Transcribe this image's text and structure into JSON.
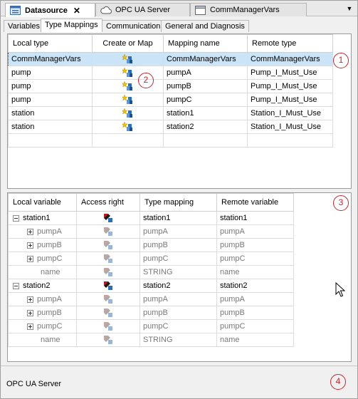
{
  "doc_tabs": [
    {
      "label": "Datasource",
      "active": true
    },
    {
      "label": "OPC UA Server",
      "active": false
    },
    {
      "label": "CommManagerVars",
      "active": false
    }
  ],
  "doc_tabs_close": "✕",
  "doc_tabs_dropdown": "▼",
  "sub_tabs": [
    "Variables",
    "Type Mappings",
    "Communication",
    "General and Diagnosis"
  ],
  "type_mappings": {
    "columns": [
      "Local type",
      "Create or Map",
      "Mapping name",
      "Remote type"
    ],
    "rows": [
      {
        "local_type": "CommManagerVars",
        "mapping_name": "CommManagerVars",
        "remote_type": "CommManagerVars",
        "selected": true
      },
      {
        "local_type": "pump",
        "mapping_name": "pumpA",
        "remote_type": "Pump_I_Must_Use"
      },
      {
        "local_type": "pump",
        "mapping_name": "pumpB",
        "remote_type": "Pump_I_Must_Use"
      },
      {
        "local_type": "pump",
        "mapping_name": "pumpC",
        "remote_type": "Pump_I_Must_Use"
      },
      {
        "local_type": "station",
        "mapping_name": "station1",
        "remote_type": "Station_I_Must_Use"
      },
      {
        "local_type": "station",
        "mapping_name": "station2",
        "remote_type": "Station_I_Must_Use"
      }
    ]
  },
  "variables": {
    "columns": [
      "Local variable",
      "Access right",
      "Type mapping",
      "Remote variable"
    ],
    "rows": [
      {
        "local_variable": "station1",
        "type_mapping": "station1",
        "remote_variable": "station1",
        "expander": "minus",
        "level": 0,
        "dim": false
      },
      {
        "local_variable": "pumpA",
        "type_mapping": "pumpA",
        "remote_variable": "pumpA",
        "expander": "plus",
        "level": 1,
        "dim": true
      },
      {
        "local_variable": "pumpB",
        "type_mapping": "pumpB",
        "remote_variable": "pumpB",
        "expander": "plus",
        "level": 1,
        "dim": true
      },
      {
        "local_variable": "pumpC",
        "type_mapping": "pumpC",
        "remote_variable": "pumpC",
        "expander": "plus",
        "level": 1,
        "dim": true
      },
      {
        "local_variable": "name",
        "type_mapping": "STRING",
        "remote_variable": "name",
        "expander": "none",
        "level": 1,
        "dim": true
      },
      {
        "local_variable": "station2",
        "type_mapping": "station2",
        "remote_variable": "station2",
        "expander": "minus",
        "level": 0,
        "dim": false
      },
      {
        "local_variable": "pumpA",
        "type_mapping": "pumpA",
        "remote_variable": "pumpA",
        "expander": "plus",
        "level": 1,
        "dim": true
      },
      {
        "local_variable": "pumpB",
        "type_mapping": "pumpB",
        "remote_variable": "pumpB",
        "expander": "plus",
        "level": 1,
        "dim": true
      },
      {
        "local_variable": "pumpC",
        "type_mapping": "pumpC",
        "remote_variable": "pumpC",
        "expander": "plus",
        "level": 1,
        "dim": true
      },
      {
        "local_variable": "name",
        "type_mapping": "STRING",
        "remote_variable": "name",
        "expander": "none",
        "level": 1,
        "dim": true
      }
    ]
  },
  "status_text": "OPC UA Server",
  "markers": [
    "1",
    "2",
    "3",
    "4"
  ],
  "icons": {
    "datasource": "datasource-icon",
    "opc_ua_server": "cloud-icon",
    "commmanager": "window-icon",
    "create_or_map": "create-map-icon",
    "access_right": "access-right-icon"
  },
  "colors": {
    "selection": "#cce4f7",
    "marker": "#c0282d",
    "dim_text": "#7a7a7a"
  }
}
